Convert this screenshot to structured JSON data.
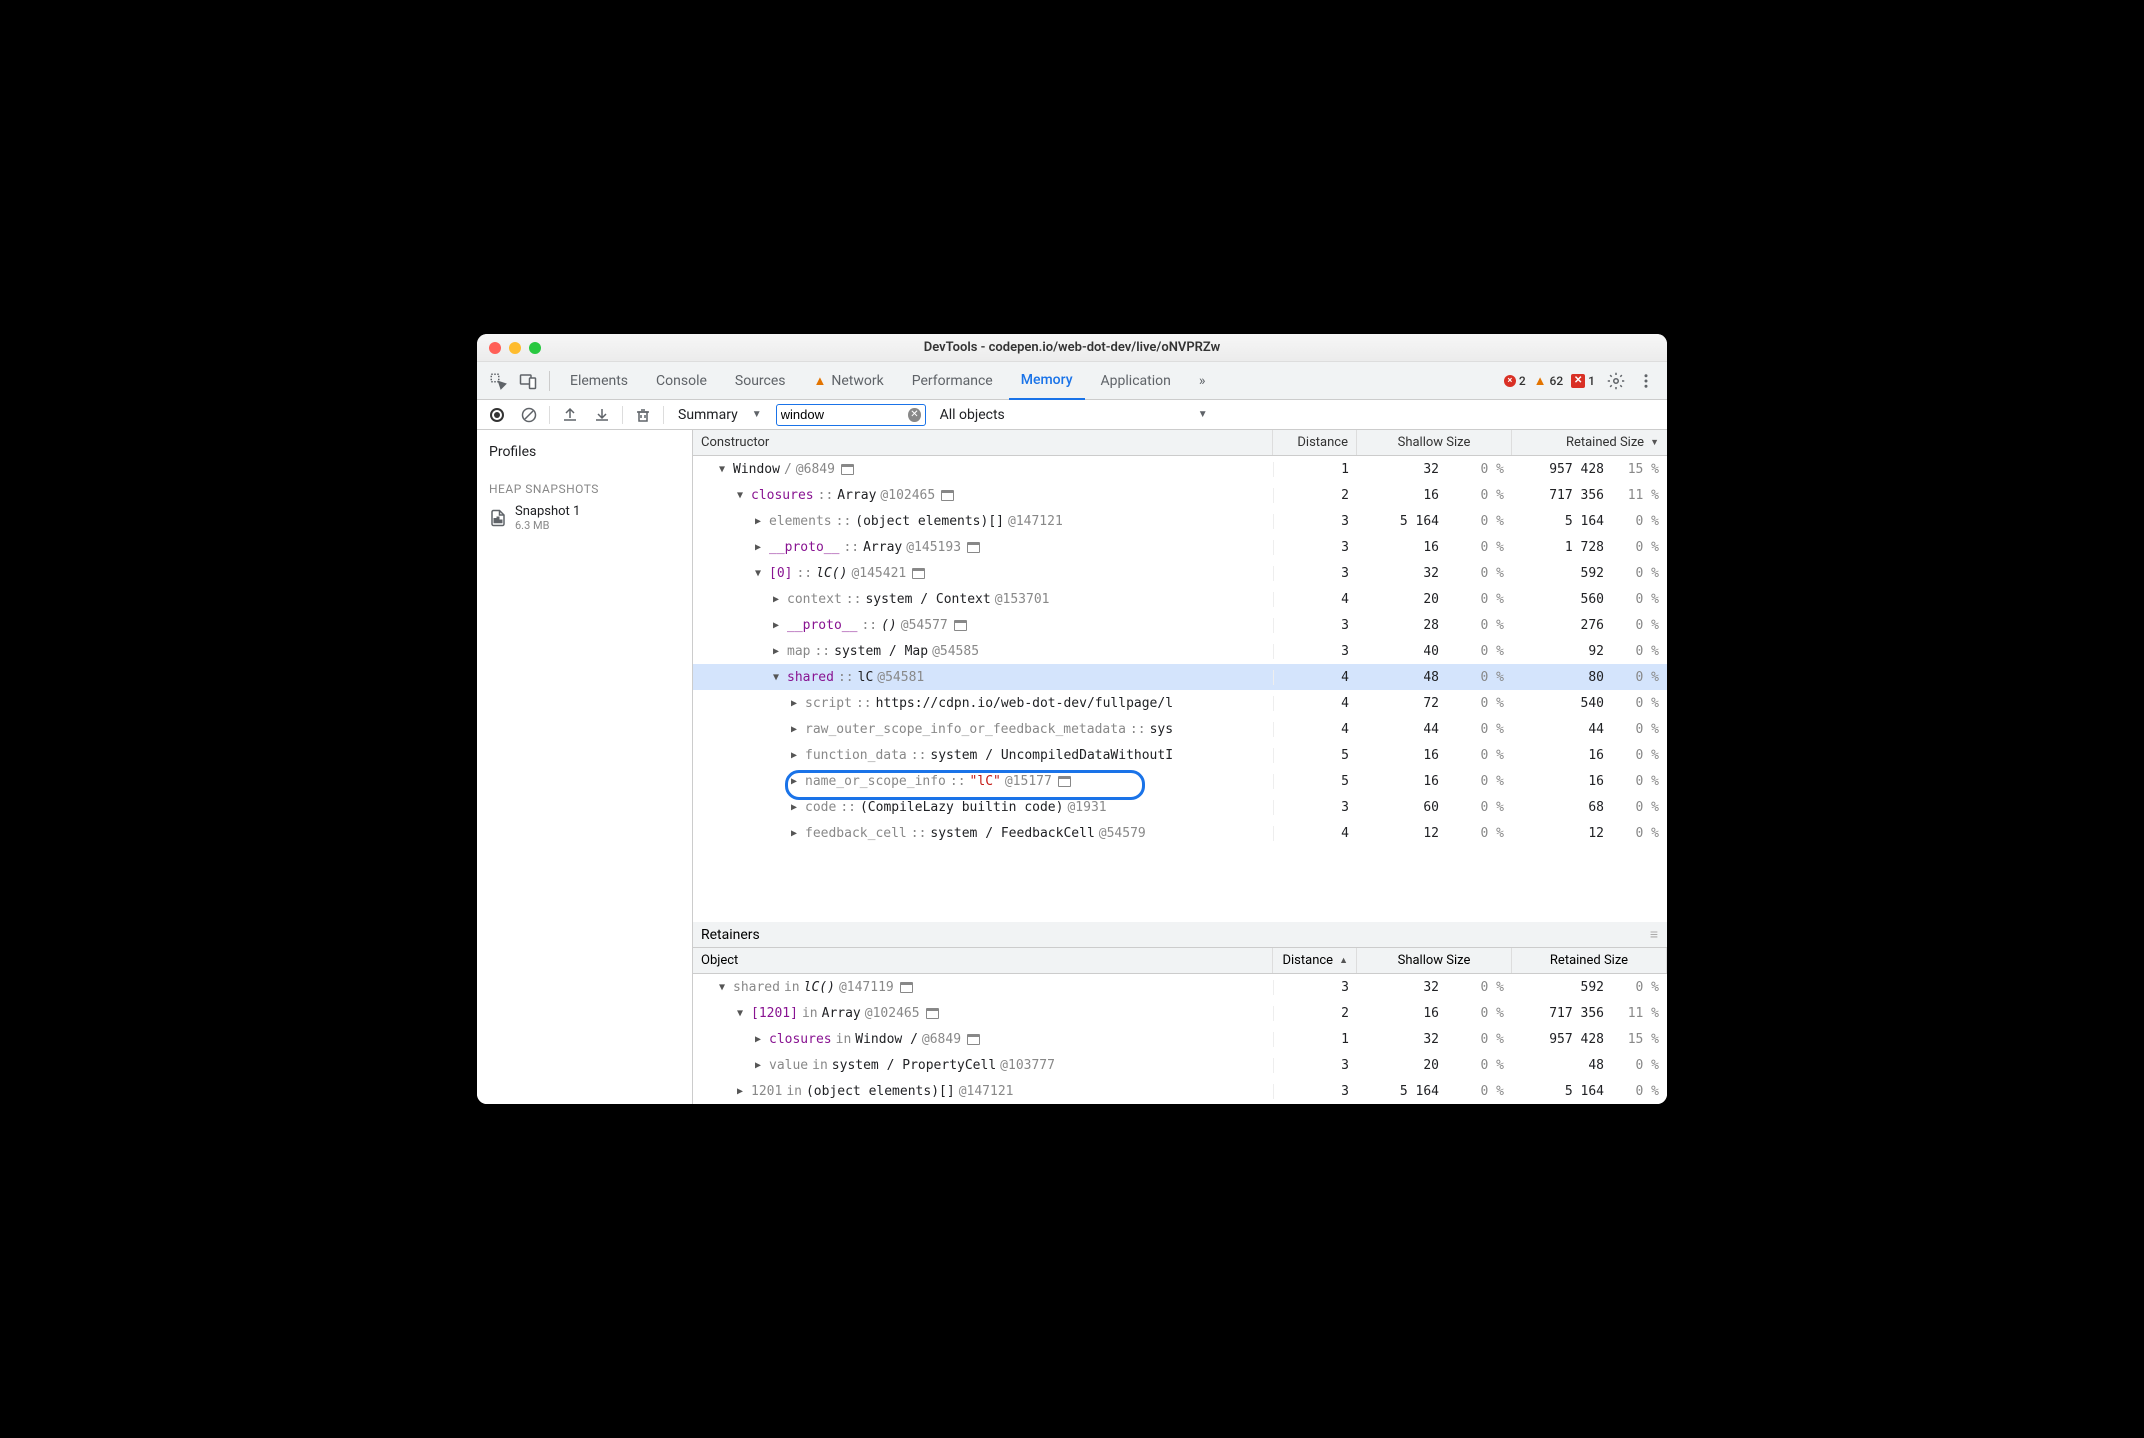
{
  "window": {
    "title": "DevTools - codepen.io/web-dot-dev/live/oNVPRZw"
  },
  "tabs": {
    "elements": "Elements",
    "console": "Console",
    "sources": "Sources",
    "network": "Network",
    "performance": "Performance",
    "memory": "Memory",
    "application": "Application",
    "more": "»"
  },
  "status": {
    "errors": "2",
    "warnings": "62",
    "issues": "1"
  },
  "toolbar": {
    "view_mode": "Summary",
    "filter_value": "window",
    "object_filter": "All objects"
  },
  "sidebar": {
    "profiles_heading": "Profiles",
    "heap_heading": "HEAP SNAPSHOTS",
    "snapshot_name": "Snapshot 1",
    "snapshot_size": "6.3 MB"
  },
  "columns": {
    "constructor": "Constructor",
    "distance": "Distance",
    "shallow": "Shallow Size",
    "retained": "Retained Size",
    "object": "Object"
  },
  "retainers_label": "Retainers",
  "rows": [
    {
      "indent": 1,
      "exp": "▼",
      "name": "Window",
      "name_cls": "type",
      "sep": " / ",
      "id": "@6849",
      "win": true,
      "d": "1",
      "s": "32",
      "sp": "0 %",
      "r": "957 428",
      "rp": "15 %"
    },
    {
      "indent": 2,
      "exp": "▼",
      "name": "closures",
      "name_cls": "prop-name",
      "sep": " :: ",
      "type": "Array",
      "id": "@102465",
      "win": true,
      "d": "2",
      "s": "16",
      "sp": "0 %",
      "r": "717 356",
      "rp": "11 %"
    },
    {
      "indent": 3,
      "exp": "▶",
      "name": "elements",
      "name_cls": "prop-name gray",
      "sep": " :: ",
      "type": "(object elements)[]",
      "id": "@147121",
      "d": "3",
      "s": "5 164",
      "sp": "0 %",
      "r": "5 164",
      "rp": "0 %"
    },
    {
      "indent": 3,
      "exp": "▶",
      "name": "__proto__",
      "name_cls": "prop-name",
      "sep": " :: ",
      "type": "Array",
      "id": "@145193",
      "win": true,
      "d": "3",
      "s": "16",
      "sp": "0 %",
      "r": "1 728",
      "rp": "0 %"
    },
    {
      "indent": 3,
      "exp": "▼",
      "name": "[0]",
      "name_cls": "prop-name",
      "sep": " :: ",
      "type_i": "lC()",
      "id": "@145421",
      "win": true,
      "d": "3",
      "s": "32",
      "sp": "0 %",
      "r": "592",
      "rp": "0 %"
    },
    {
      "indent": 4,
      "exp": "▶",
      "name": "context",
      "name_cls": "prop-name gray",
      "sep": " :: ",
      "type": "system / Context",
      "id": "@153701",
      "d": "4",
      "s": "20",
      "sp": "0 %",
      "r": "560",
      "rp": "0 %"
    },
    {
      "indent": 4,
      "exp": "▶",
      "name": "__proto__",
      "name_cls": "prop-name",
      "sep": " :: ",
      "type_i": "()",
      "id": "@54577",
      "win": true,
      "d": "3",
      "s": "28",
      "sp": "0 %",
      "r": "276",
      "rp": "0 %"
    },
    {
      "indent": 4,
      "exp": "▶",
      "name": "map",
      "name_cls": "prop-name gray",
      "sep": " :: ",
      "type": "system / Map",
      "id": "@54585",
      "d": "3",
      "s": "40",
      "sp": "0 %",
      "r": "92",
      "rp": "0 %"
    },
    {
      "indent": 4,
      "exp": "▼",
      "name": "shared",
      "name_cls": "prop-name",
      "sep": " :: ",
      "type": "lC",
      "id": "@54581",
      "d": "4",
      "s": "48",
      "sp": "0 %",
      "r": "80",
      "rp": "0 %",
      "selected": true
    },
    {
      "indent": 5,
      "exp": "▶",
      "name": "script",
      "name_cls": "prop-name gray",
      "sep": " :: ",
      "type": "https://cdpn.io/web-dot-dev/fullpage/l",
      "d": "4",
      "s": "72",
      "sp": "0 %",
      "r": "540",
      "rp": "0 %"
    },
    {
      "indent": 5,
      "exp": "▶",
      "name": "raw_outer_scope_info_or_feedback_metadata",
      "name_cls": "prop-name gray",
      "sep": " :: ",
      "type": "sys",
      "d": "4",
      "s": "44",
      "sp": "0 %",
      "r": "44",
      "rp": "0 %"
    },
    {
      "indent": 5,
      "exp": "▶",
      "name": "function_data",
      "name_cls": "prop-name gray",
      "sep": " :: ",
      "type": "system / UncompiledDataWithoutI",
      "d": "5",
      "s": "16",
      "sp": "0 %",
      "r": "16",
      "rp": "0 %"
    },
    {
      "indent": 5,
      "exp": "▶",
      "name": "name_or_scope_info",
      "name_cls": "prop-name gray",
      "sep": " :: ",
      "str": "\"lC\"",
      "id": "@15177",
      "win": true,
      "d": "5",
      "s": "16",
      "sp": "0 %",
      "r": "16",
      "rp": "0 %",
      "highlight": true
    },
    {
      "indent": 5,
      "exp": "▶",
      "name": "code",
      "name_cls": "prop-name gray",
      "sep": " :: ",
      "type": "(CompileLazy builtin code)",
      "id": "@1931",
      "d": "3",
      "s": "60",
      "sp": "0 %",
      "r": "68",
      "rp": "0 %"
    },
    {
      "indent": 5,
      "exp": "▶",
      "name": "feedback_cell",
      "name_cls": "prop-name gray",
      "sep": " :: ",
      "type": "system / FeedbackCell",
      "id": "@54579",
      "d": "4",
      "s": "12",
      "sp": "0 %",
      "r": "12",
      "rp": "0 %"
    }
  ],
  "retainer_rows": [
    {
      "indent": 1,
      "exp": "▼",
      "name": "shared",
      "name_cls": "prop-name gray",
      "in": " in ",
      "type_i": "lC()",
      "id": "@147119",
      "win": true,
      "d": "3",
      "s": "32",
      "sp": "0 %",
      "r": "592",
      "rp": "0 %"
    },
    {
      "indent": 2,
      "exp": "▼",
      "name": "[1201]",
      "name_cls": "prop-name",
      "in": " in ",
      "type": "Array",
      "id": "@102465",
      "win": true,
      "d": "2",
      "s": "16",
      "sp": "0 %",
      "r": "717 356",
      "rp": "11 %"
    },
    {
      "indent": 3,
      "exp": "▶",
      "name": "closures",
      "name_cls": "prop-name",
      "in": " in ",
      "type": "Window / ",
      "id": "@6849",
      "win": true,
      "d": "1",
      "s": "32",
      "sp": "0 %",
      "r": "957 428",
      "rp": "15 %"
    },
    {
      "indent": 3,
      "exp": "▶",
      "name": "value",
      "name_cls": "prop-name gray",
      "in": " in ",
      "type": "system / PropertyCell",
      "id": "@103777",
      "d": "3",
      "s": "20",
      "sp": "0 %",
      "r": "48",
      "rp": "0 %"
    },
    {
      "indent": 2,
      "exp": "▶",
      "name": "1201",
      "name_cls": "prop-name gray",
      "in": " in ",
      "type": "(object elements)[]",
      "id": "@147121",
      "d": "3",
      "s": "5 164",
      "sp": "0 %",
      "r": "5 164",
      "rp": "0 %"
    }
  ]
}
